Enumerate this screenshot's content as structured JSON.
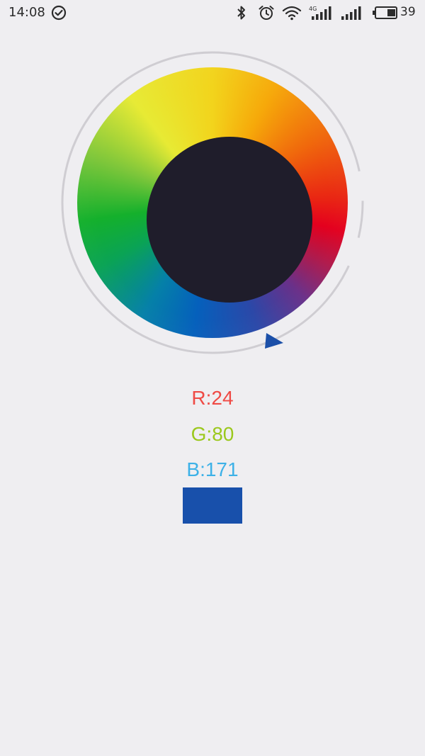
{
  "status_bar": {
    "time": "14:08",
    "battery_level": "39",
    "icons": [
      "check-circle-icon",
      "bluetooth-icon",
      "alarm-icon",
      "wifi-icon",
      "cell-signal-4g-icon",
      "cell-signal-icon",
      "battery-icon"
    ],
    "network_label": "4G"
  },
  "picker": {
    "selected_color": "#1850ab",
    "pointer_color": "#1b4fa8",
    "center_color": "#1f1d2b",
    "ring_color": "#cfcdd2"
  },
  "rgb": {
    "r_label": "R:24",
    "g_label": "G:80",
    "b_label": "B:171",
    "r_color": "#ef4a45",
    "g_color": "#9bc81c",
    "b_color": "#3db1e7"
  }
}
